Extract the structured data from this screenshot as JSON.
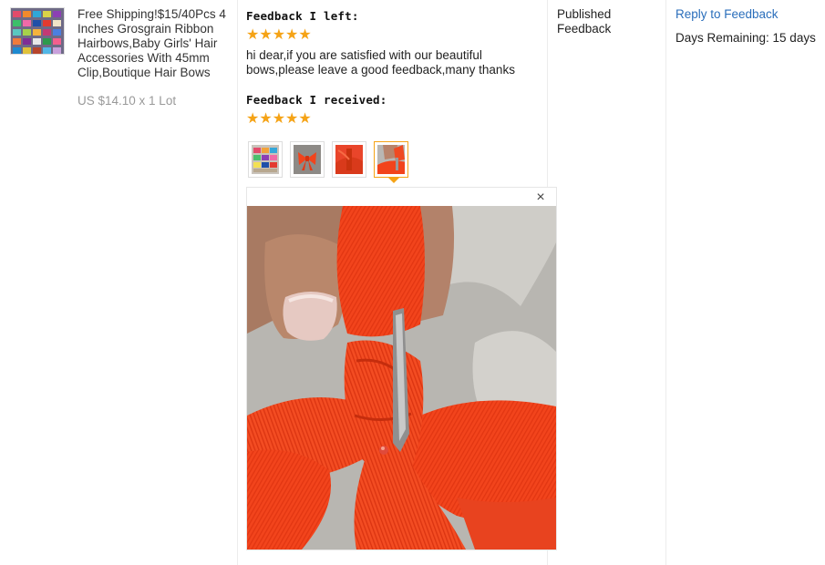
{
  "product": {
    "thumbnail_icon": "hair-bows-product-photo",
    "title": "Free Shipping!$15/40Pcs 4 Inches Grosgrain Ribbon Hairbows,Baby Girls' Hair Accessories With 45mm Clip,Boutique Hair Bows",
    "price": "US $14.10 x 1 Lot"
  },
  "feedback_left": {
    "heading": "Feedback I left:",
    "stars": "★★★★★",
    "rating": 5,
    "text": "hi dear,if you are satisfied with our beautiful bows,please leave a good feedback,many thanks"
  },
  "feedback_received": {
    "heading": "Feedback I received:",
    "stars": "★★★★★",
    "rating": 5,
    "photos": [
      "colorful-bows-photo",
      "single-bow-photo",
      "orange-bow-photo",
      "bow-clip-photo"
    ],
    "selected_photo": 4,
    "close_icon": "×"
  },
  "status": {
    "text": "Published Feedback"
  },
  "actions": {
    "reply_link": "Reply to Feedback",
    "days_remaining": "Days Remaining: 15 days"
  },
  "colors": {
    "star": "#f5a316",
    "link": "#2a6ebb",
    "ribbon": "#f2441c"
  }
}
